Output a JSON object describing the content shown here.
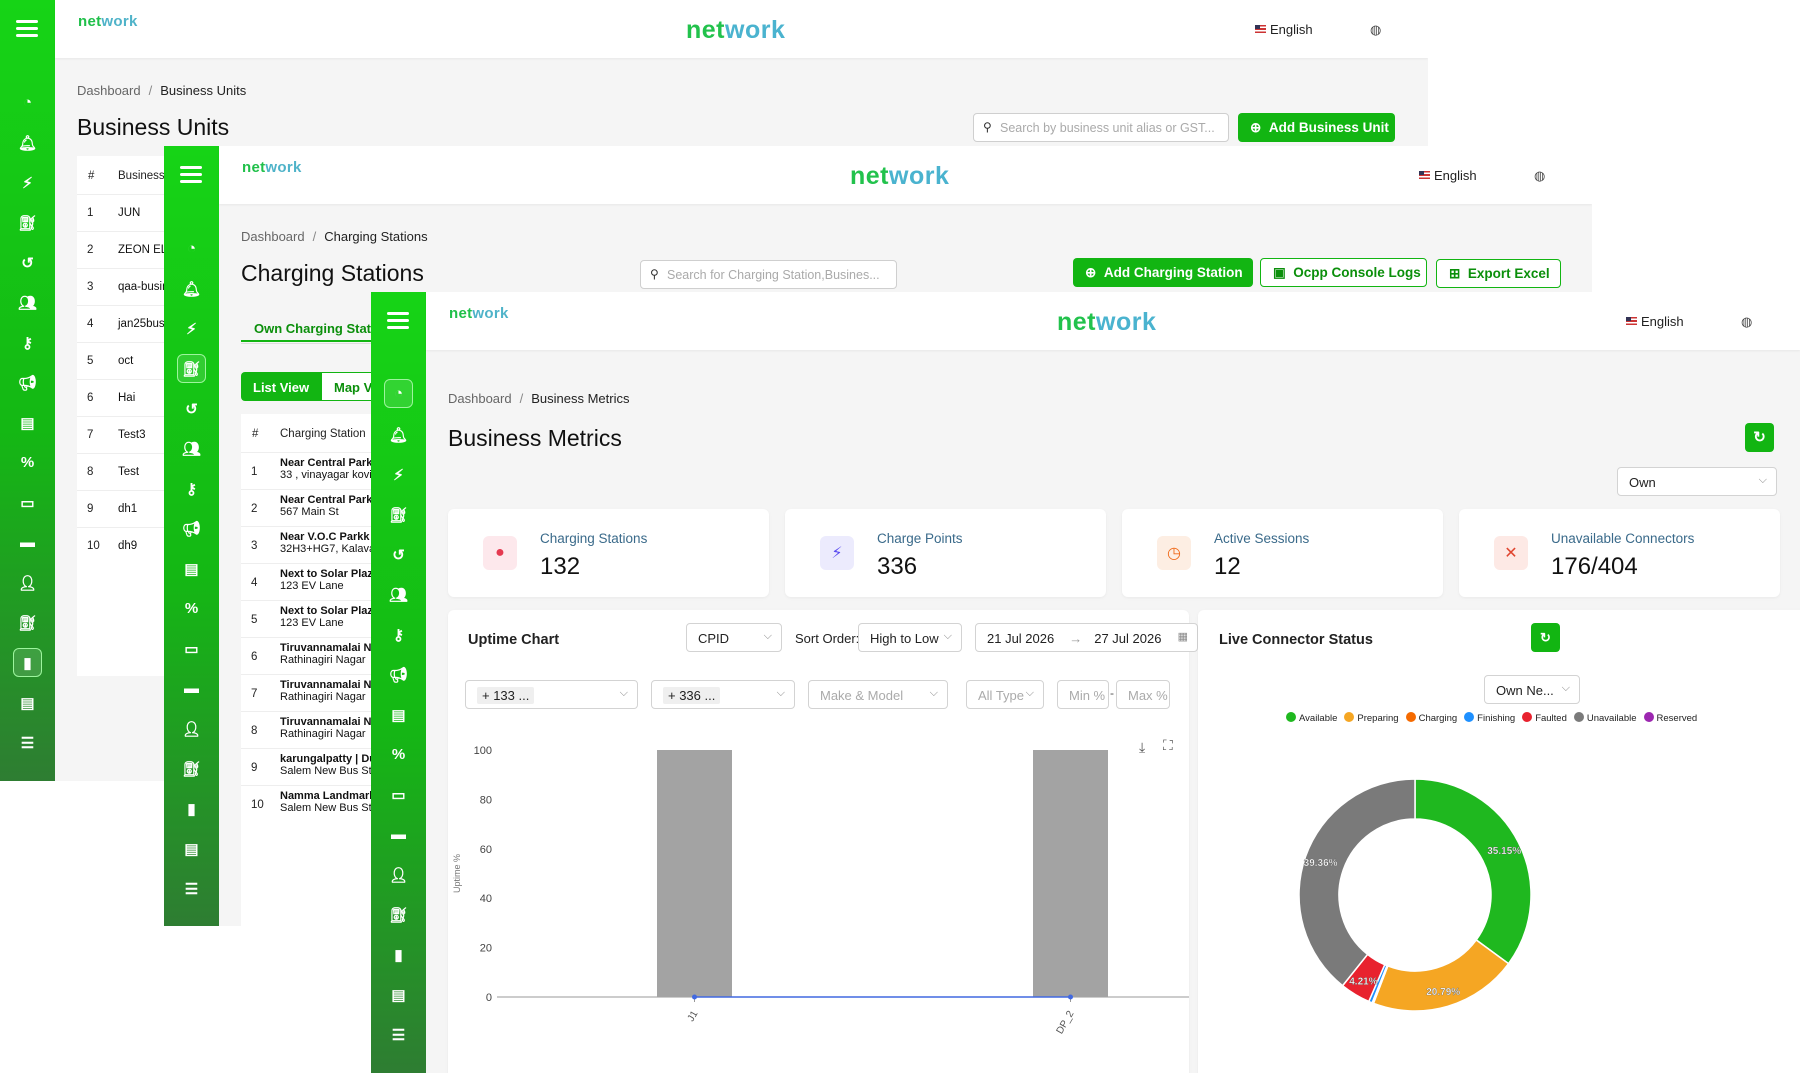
{
  "app": {
    "logo_net": "net",
    "logo_work": "work",
    "language": "English",
    "globe_icon": "globe-icon"
  },
  "window1": {
    "breadcrumb": {
      "home": "Dashboard",
      "current": "Business Units"
    },
    "title": "Business Units",
    "search_placeholder": "Search by business unit alias or GST...",
    "add_button": "Add Business Unit",
    "table": {
      "headers": [
        "#",
        "Business"
      ],
      "rows": [
        {
          "num": "1",
          "name": "JUN"
        },
        {
          "num": "2",
          "name": "ZEON ELE"
        },
        {
          "num": "3",
          "name": "qaa-busin"
        },
        {
          "num": "4",
          "name": "jan25bus"
        },
        {
          "num": "5",
          "name": "oct"
        },
        {
          "num": "6",
          "name": "Hai"
        },
        {
          "num": "7",
          "name": "Test3"
        },
        {
          "num": "8",
          "name": "Test"
        },
        {
          "num": "9",
          "name": "dh1"
        },
        {
          "num": "10",
          "name": "dh9"
        }
      ]
    }
  },
  "window2": {
    "breadcrumb": {
      "home": "Dashboard",
      "current": "Charging Stations"
    },
    "title": "Charging Stations",
    "search_placeholder": "Search for Charging Station,Busines...",
    "add_button": "Add Charging Station",
    "ocpp_button": "Ocpp Console Logs",
    "export_button": "Export Excel",
    "tab_own": "Own Charging Statio",
    "view_list": "List View",
    "view_map": "Map V",
    "table": {
      "headers": [
        "#",
        "Charging Station"
      ],
      "rows": [
        {
          "num": "1",
          "name": "Near Central Park",
          "addr": "33 , vinayagar kovi"
        },
        {
          "num": "2",
          "name": "Near Central Park",
          "addr": "567 Main St"
        },
        {
          "num": "3",
          "name": "Near V.O.C Parkk |",
          "addr": "32H3+HG7, Kalava"
        },
        {
          "num": "4",
          "name": "Next to Solar Plaz",
          "addr": "123 EV Lane"
        },
        {
          "num": "5",
          "name": "Next to Solar Plaz",
          "addr": "123 EV Lane"
        },
        {
          "num": "6",
          "name": "Tiruvannamalai Na",
          "addr": "Rathinagiri Nagar"
        },
        {
          "num": "7",
          "name": "Tiruvannamalai Na",
          "addr": "Rathinagiri Nagar"
        },
        {
          "num": "8",
          "name": "Tiruvannamalai Na",
          "addr": "Rathinagiri Nagar"
        },
        {
          "num": "9",
          "name": "karungalpatty | Du",
          "addr": "Salem New Bus St"
        },
        {
          "num": "10",
          "name": "Namma Landmark",
          "addr": "Salem New Bus St"
        }
      ]
    }
  },
  "window3": {
    "breadcrumb": {
      "home": "Dashboard",
      "current": "Business Metrics"
    },
    "title": "Business Metrics",
    "ownership_select": "Own",
    "metrics": [
      {
        "label": "Charging Stations",
        "value": "132",
        "icon": "map-pin-icon",
        "color": "#e53950",
        "bg": "#fde8ec"
      },
      {
        "label": "Charge Points",
        "value": "336",
        "icon": "lightning-icon",
        "color": "#5b4cf0",
        "bg": "#ecebfd"
      },
      {
        "label": "Active Sessions",
        "value": "12",
        "icon": "clock-icon",
        "color": "#f06a1a",
        "bg": "#fdeee3"
      },
      {
        "label": "Unavailable Connectors",
        "value": "176/404",
        "icon": "plug-off-icon",
        "color": "#e0452f",
        "bg": "#fde9e5"
      }
    ],
    "uptime": {
      "title": "Uptime Chart",
      "group_by": "CPID",
      "sort_label": "Sort Order:",
      "sort_value": "High to Low",
      "date_from": "21 Jul 2026",
      "date_to": "27 Jul 2026",
      "filter_stations": "+ 133 ...",
      "filter_points": "+ 336 ...",
      "filter_make": "Make & Model",
      "filter_type": "All Type",
      "min_placeholder": "Min %",
      "max_placeholder": "Max %",
      "range_dash": "-"
    },
    "live": {
      "title": "Live Connector Status",
      "select": "Own Ne..."
    }
  },
  "chart_data": [
    {
      "type": "bar",
      "title": "Uptime Chart",
      "ylabel": "Uptime %",
      "ylim": [
        0,
        100
      ],
      "yticks": [
        0,
        20,
        40,
        60,
        80,
        100
      ],
      "categories": [
        "J1",
        "DP_2"
      ],
      "series": [
        {
          "values": [
            100,
            100
          ],
          "color": "#a3a3a3"
        }
      ],
      "line_values": [
        0,
        0
      ],
      "line_color": "#4169e1"
    },
    {
      "type": "pie",
      "title": "Live Connector Status",
      "donut": true,
      "legend_position": "top",
      "slices": [
        {
          "label": "Available",
          "value": 35.15,
          "display": "35.15%",
          "color": "#1fb81f"
        },
        {
          "label": "Preparing",
          "value": 20.79,
          "display": "20.79%",
          "color": "#f5a623"
        },
        {
          "label": "Charging",
          "value": 0.2,
          "display": "",
          "color": "#f56a00"
        },
        {
          "label": "Finishing",
          "value": 0.5,
          "display": "",
          "color": "#1e90ff"
        },
        {
          "label": "Faulted",
          "value": 4.21,
          "display": "4.21%",
          "color": "#e8222e"
        },
        {
          "label": "Unavailable",
          "value": 39.36,
          "display": "39.36%",
          "color": "#7a7a7a"
        },
        {
          "label": "Reserved",
          "value": 0,
          "display": "",
          "color": "#9c27b0"
        }
      ]
    }
  ]
}
